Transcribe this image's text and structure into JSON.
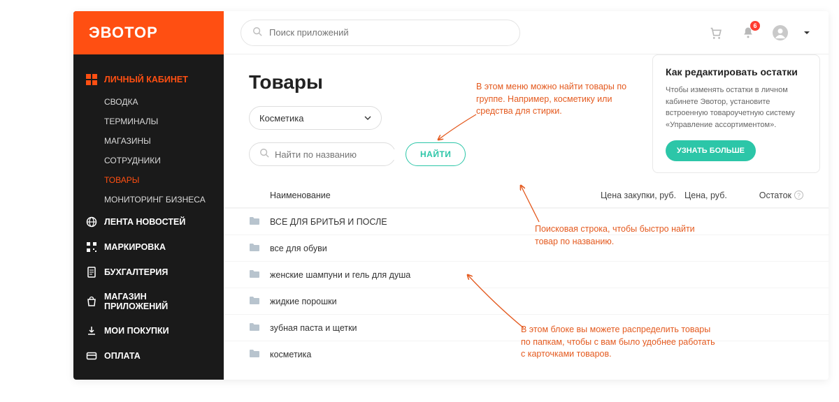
{
  "brand": "ЭВОТОР",
  "topbar": {
    "search_placeholder": "Поиск приложений",
    "notification_count": "6"
  },
  "sidebar": {
    "groups": [
      {
        "label": "ЛИЧНЫЙ КАБИНЕТ",
        "active": true,
        "subs": [
          {
            "label": "СВОДКА",
            "key": "summary"
          },
          {
            "label": "ТЕРМИНАЛЫ",
            "key": "terminals"
          },
          {
            "label": "МАГАЗИНЫ",
            "key": "stores"
          },
          {
            "label": "СОТРУДНИКИ",
            "key": "staff"
          },
          {
            "label": "ТОВАРЫ",
            "key": "products",
            "active": true
          },
          {
            "label": "МОНИТОРИНГ БИЗНЕСА",
            "key": "monitoring"
          }
        ]
      },
      {
        "label": "ЛЕНТА НОВОСТЕЙ"
      },
      {
        "label": "МАРКИРОВКА"
      },
      {
        "label": "БУХГАЛТЕРИЯ"
      },
      {
        "label": "МАГАЗИН ПРИЛОЖЕНИЙ"
      },
      {
        "label": "МОИ ПОКУПКИ"
      },
      {
        "label": "ОПЛАТА"
      }
    ]
  },
  "page": {
    "title": "Товары",
    "dropdown_value": "Косметика",
    "name_search_placeholder": "Найти по названию",
    "find_button": "НАЙТИ"
  },
  "info_card": {
    "title": "Как редактировать остатки",
    "body": "Чтобы изменять остатки в личном кабинете Эвотор, установите встроенную товароучетную систему «Управление ассортиментом».",
    "button": "УЗНАТЬ БОЛЬШЕ"
  },
  "table": {
    "headers": {
      "name": "Наименование",
      "purchase": "Цена закупки, руб.",
      "price": "Цена, руб.",
      "stock": "Остаток"
    },
    "rows": [
      {
        "name": "ВСЕ ДЛЯ БРИТЬЯ И ПОСЛЕ"
      },
      {
        "name": "все для обуви"
      },
      {
        "name": "женские шампуни и гель для душа"
      },
      {
        "name": "жидкие порошки"
      },
      {
        "name": "зубная паста и щетки"
      },
      {
        "name": "косметика"
      }
    ]
  },
  "annotations": {
    "a1": "В этом меню можно найти товары по группе. Например, косметику или средства для стирки.",
    "a2": "Поисковая строка, чтобы быстро найти товар по названию.",
    "a3": "В этом блоке вы можете распределить товары по папкам, чтобы с вам было удобнее работать с карточками товаров."
  }
}
